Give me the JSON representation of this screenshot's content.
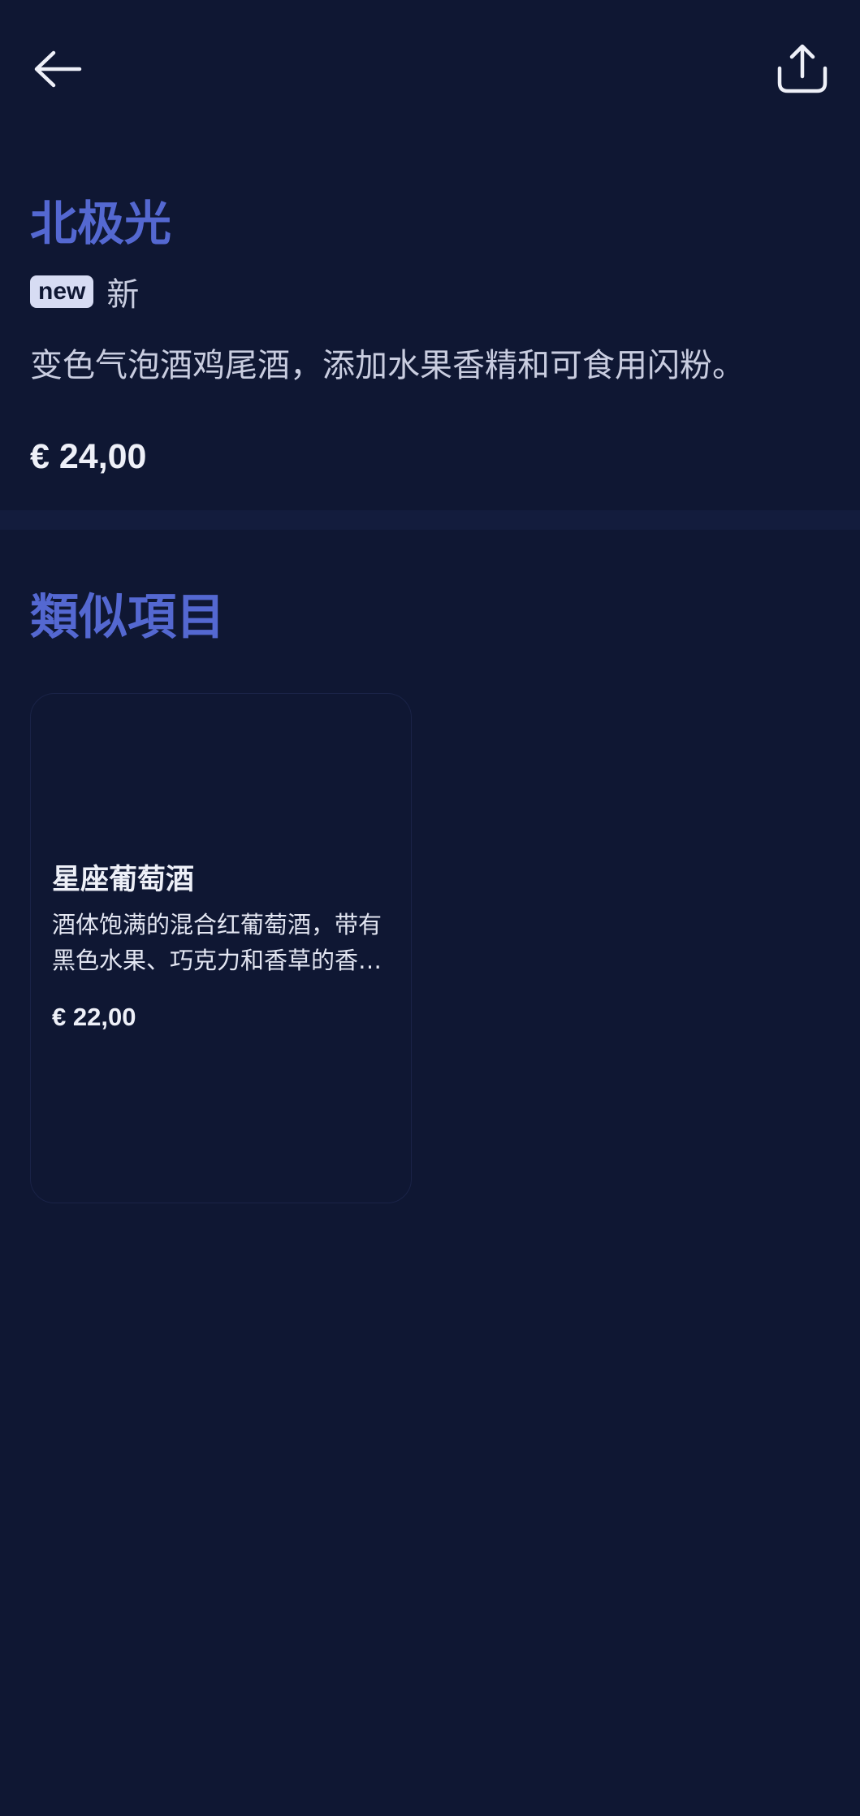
{
  "header": {
    "back_icon": "arrow-left-icon",
    "share_icon": "share-icon"
  },
  "product": {
    "title": "北极光",
    "badge": "new",
    "tag": "新",
    "description": "变色气泡酒鸡尾酒，添加水果香精和可食用闪粉。",
    "price": "€ 24,00"
  },
  "similar": {
    "title": "類似項目",
    "items": [
      {
        "name": "星座葡萄酒",
        "description": "酒体饱满的混合红葡萄酒，带有黑色水果、巧克力和香草的香味。",
        "price": "€ 22,00"
      }
    ]
  },
  "colors": {
    "background": "#0f1733",
    "accent": "#5468d1",
    "badge_bg": "#d7dcf3",
    "divider": "#131c3d"
  }
}
